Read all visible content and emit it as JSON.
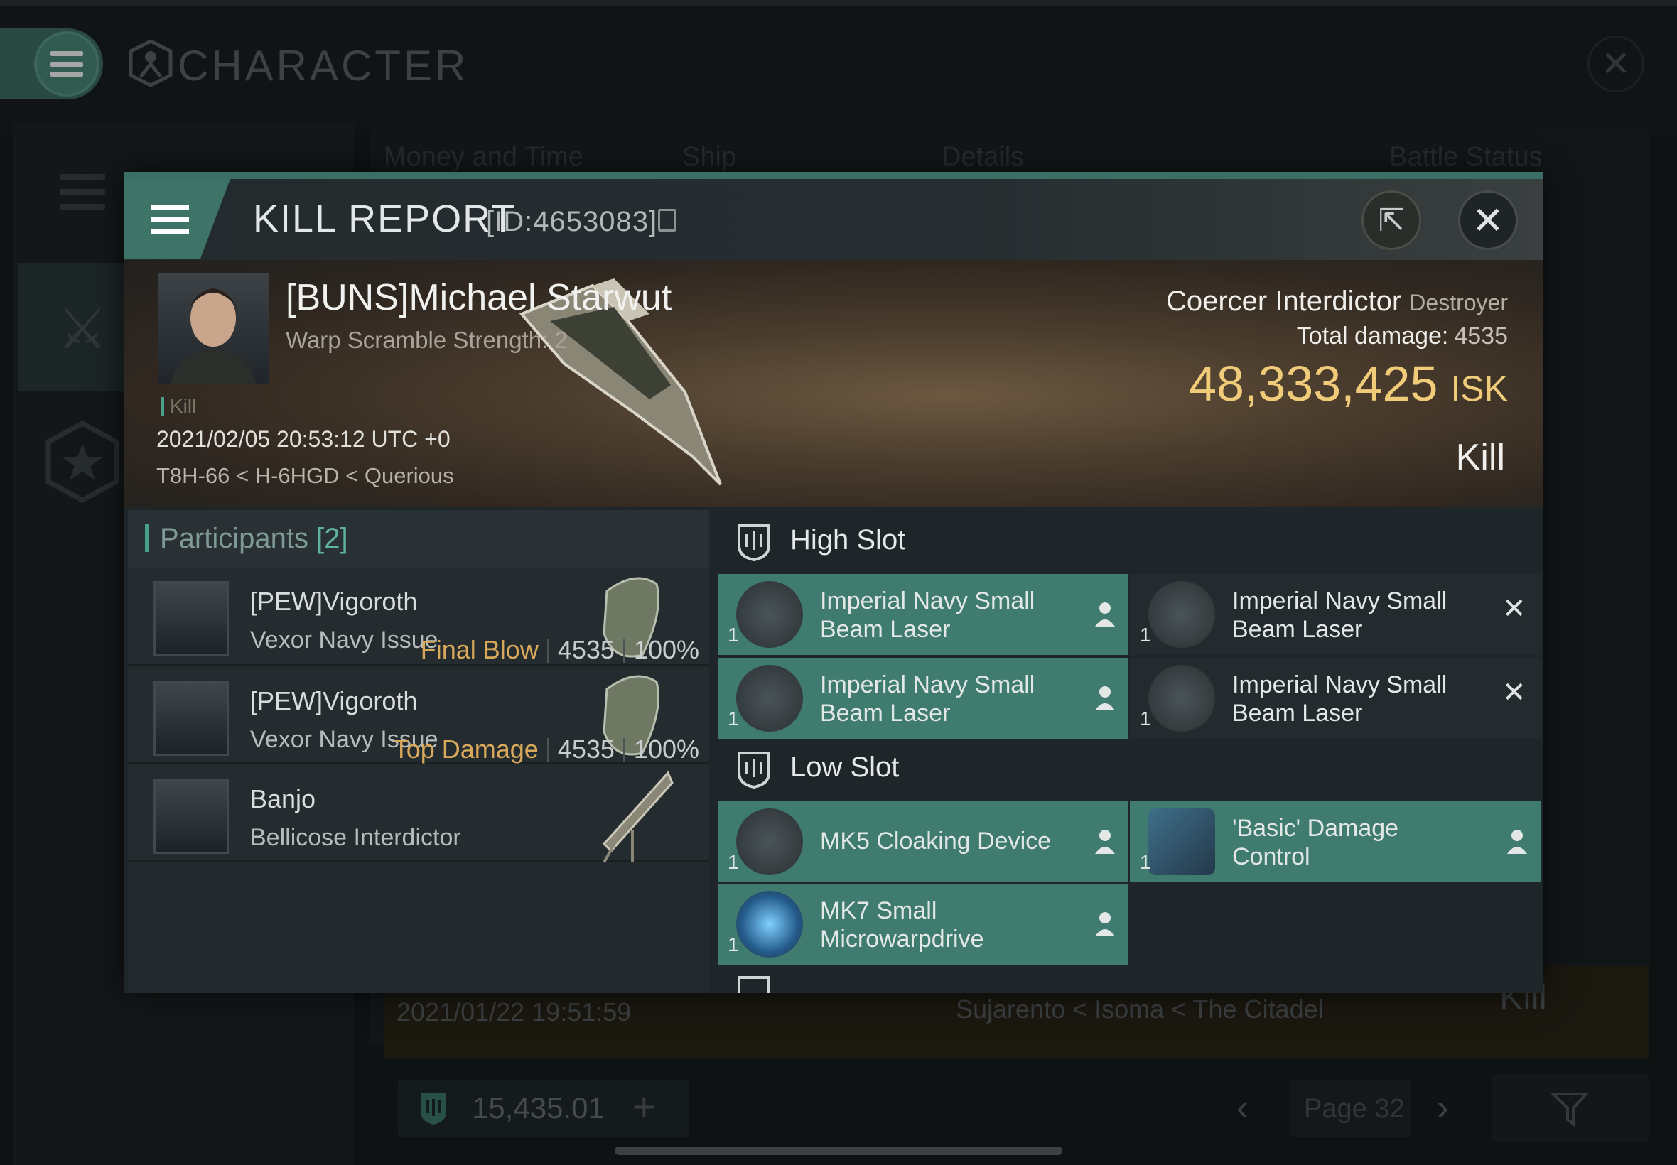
{
  "app": {
    "title": "CHARACTER"
  },
  "background": {
    "table_headers": [
      "Money and Time",
      "Ship",
      "Details",
      "Battle Status"
    ],
    "row_time": "2021/01/22  19:51:59",
    "row_location": "Sujarento < Isoma < The Citadel",
    "row_result": "Kill",
    "wallet": "15,435.01",
    "page": "Page 32"
  },
  "kill_report": {
    "title": "KILL REPORT",
    "id": "[ID:4653083]",
    "victim": {
      "name": "[BUNS]Michael Starwut",
      "scram": "Warp Scramble Strength: 2",
      "tag": "Kill",
      "timestamp": "2021/02/05 20:53:12 UTC +0",
      "location": "T8H-66 < H-6HGD < Querious",
      "ship_name": "Coercer Interdictor",
      "ship_class": "Destroyer",
      "total_damage_label": "Total damage:",
      "total_damage": "4535",
      "isk_value": "48,333,425",
      "isk_unit": "ISK",
      "result": "Kill"
    },
    "participants": {
      "title": "Participants",
      "count": "[2]",
      "rows": [
        {
          "name": "[PEW]Vigoroth",
          "ship": "Vexor Navy Issue",
          "label": "Final Blow",
          "damage": "4535",
          "percent": "100%"
        },
        {
          "name": "[PEW]Vigoroth",
          "ship": "Vexor Navy Issue",
          "label": "Top Damage",
          "damage": "4535",
          "percent": "100%"
        },
        {
          "name": "Banjo",
          "ship": "Bellicose Interdictor",
          "label": "",
          "damage": "",
          "percent": ""
        }
      ]
    },
    "fitting": {
      "high_slot_label": "High Slot",
      "low_slot_label": "Low Slot",
      "high": [
        {
          "name": "Imperial Navy Small Beam Laser",
          "qty": "1",
          "status": "dropped"
        },
        {
          "name": "Imperial Navy Small Beam Laser",
          "qty": "1",
          "status": "destroyed"
        },
        {
          "name": "Imperial Navy Small Beam Laser",
          "qty": "1",
          "status": "dropped"
        },
        {
          "name": "Imperial Navy Small Beam Laser",
          "qty": "1",
          "status": "destroyed"
        }
      ],
      "low": [
        {
          "name": "MK5 Cloaking Device",
          "qty": "1",
          "status": "dropped"
        },
        {
          "name": "'Basic' Damage Control",
          "qty": "1",
          "status": "dropped"
        },
        {
          "name": "MK7 Small Microwarpdrive",
          "qty": "1",
          "status": "dropped"
        }
      ]
    }
  },
  "colors": {
    "accent": "#3f7b6f",
    "isk": "#f0cb7a",
    "final_blow": "#d9a95b"
  }
}
